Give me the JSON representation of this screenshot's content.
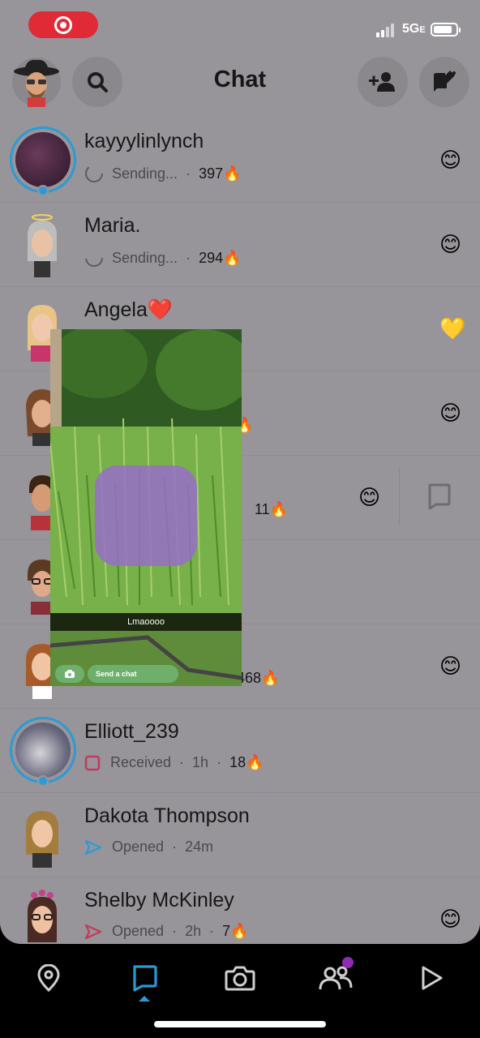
{
  "header": {
    "title": "Chat"
  },
  "status_bar": {
    "network": "5G",
    "network_suffix": "E"
  },
  "chats": [
    {
      "name": "kayyylinlynch",
      "status": "Sending...",
      "streak": "397",
      "streak_emoji": "🔥",
      "friend_emoji": "😊",
      "status_icon": "sending-spinner-icon"
    },
    {
      "name": "Maria.",
      "status": "Sending...",
      "streak": "294",
      "streak_emoji": "🔥",
      "friend_emoji": "😊",
      "status_icon": "sending-spinner-icon"
    },
    {
      "name": "Angela",
      "name_emoji": "❤️",
      "friend_emoji": "💛"
    },
    {
      "friend_emoji": "😊",
      "streak_emoji": "🔥"
    },
    {
      "streak": "11",
      "streak_emoji": "🔥",
      "friend_emoji": "😊"
    },
    {},
    {
      "streak": "468",
      "streak_emoji": "🔥",
      "friend_emoji": "😊"
    },
    {
      "name": "Elliott_239",
      "status": "Received",
      "time": "1h",
      "streak": "18",
      "streak_emoji": "🔥",
      "status_icon": "received-square-icon"
    },
    {
      "name": "Dakota Thompson",
      "status": "Opened",
      "time": "24m",
      "status_icon": "opened-arrow-icon"
    },
    {
      "name": "Shelby McKinley",
      "status": "Opened",
      "time": "2h",
      "streak": "7",
      "streak_emoji": "🔥",
      "friend_emoji": "😊",
      "status_icon": "opened-arrow-icon"
    }
  ],
  "snap_preview": {
    "caption": "Lmaoooo",
    "send_label": "Send a chat"
  },
  "colors": {
    "background": "#97959a",
    "accent": "#2b9ad6",
    "received": "#c23a5a",
    "record": "#e02a36"
  }
}
